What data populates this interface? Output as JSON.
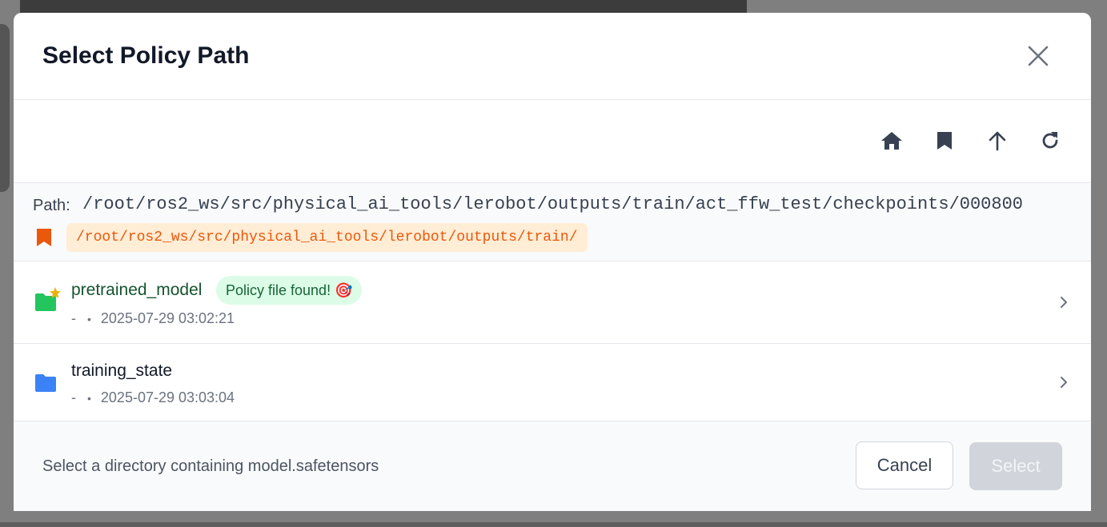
{
  "dialog": {
    "title": "Select Policy Path"
  },
  "toolbar": {
    "buttons": [
      "home-icon",
      "bookmark-icon",
      "arrow-up-icon",
      "refresh-icon"
    ]
  },
  "path": {
    "label": "Path:",
    "current": "/root/ros2_ws/src/physical_ai_tools/lerobot/outputs/train/act_ffw_test/checkpoints/000800",
    "bookmark": "/root/ros2_ws/src/physical_ai_tools/lerobot/outputs/train/"
  },
  "entries": [
    {
      "name": "pretrained_model",
      "badge": "Policy file found! 🎯",
      "size": "-",
      "separator": "•",
      "modified": "2025-07-29 03:02:21",
      "icon": "folder-green-icon"
    },
    {
      "name": "training_state",
      "size": "-",
      "separator": "•",
      "modified": "2025-07-29 03:03:04",
      "icon": "folder-blue-icon"
    }
  ],
  "footer": {
    "hint": "Select a directory containing model.safetensors",
    "cancel_label": "Cancel",
    "select_label": "Select"
  },
  "colors": {
    "title": "#111827",
    "bookmark_chip_bg": "#ffedd5",
    "bookmark_text": "#ea580c",
    "badge_bg": "#dcfce7",
    "badge_text": "#166534",
    "folder_green": "#22c55e",
    "folder_blue": "#3b82f6",
    "select_disabled": "#d1d5db"
  }
}
